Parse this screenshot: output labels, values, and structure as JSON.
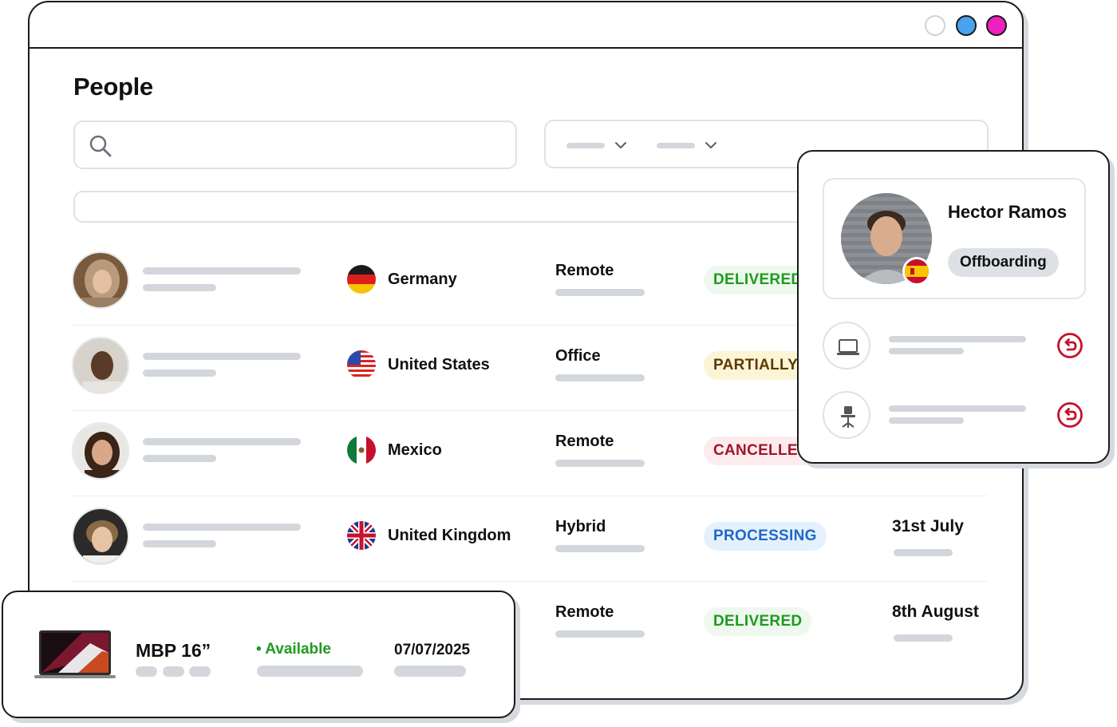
{
  "page": {
    "title": "People"
  },
  "colors": {
    "delivered": "#1e9b1e",
    "partially": "#5c3a05",
    "cancelled": "#a3142a",
    "processing": "#1f67c7",
    "window_dot_blue": "#4aa3f0",
    "window_dot_magenta": "#f01fc1"
  },
  "icons": {
    "search": "search-icon",
    "chevron": "chevron-down-icon",
    "laptop": "laptop-icon",
    "chair": "office-chair-icon",
    "return": "return-icon"
  },
  "people": [
    {
      "country": "Germany",
      "flag": "germany-flag-icon",
      "work_type": "Remote",
      "status": "DELIVERED",
      "date": ""
    },
    {
      "country": "United States",
      "flag": "us-flag-icon",
      "work_type": "Office",
      "status": "PARTIALLY",
      "date": ""
    },
    {
      "country": "Mexico",
      "flag": "mexico-flag-icon",
      "work_type": "Remote",
      "status": "CANCELLED",
      "date": ""
    },
    {
      "country": "United Kingdom",
      "flag": "uk-flag-icon",
      "work_type": "Hybrid",
      "status": "PROCESSING",
      "date": "31st July"
    },
    {
      "country": "",
      "flag": "",
      "work_type": "Remote",
      "status": "DELIVERED",
      "date": "8th August"
    }
  ],
  "profile_card": {
    "name": "Hector Ramos",
    "status": "Offboarding",
    "flag": "spain-flag-icon"
  },
  "device_card": {
    "device": "MBP 16”",
    "availability": "Available",
    "date": "07/07/2025"
  }
}
